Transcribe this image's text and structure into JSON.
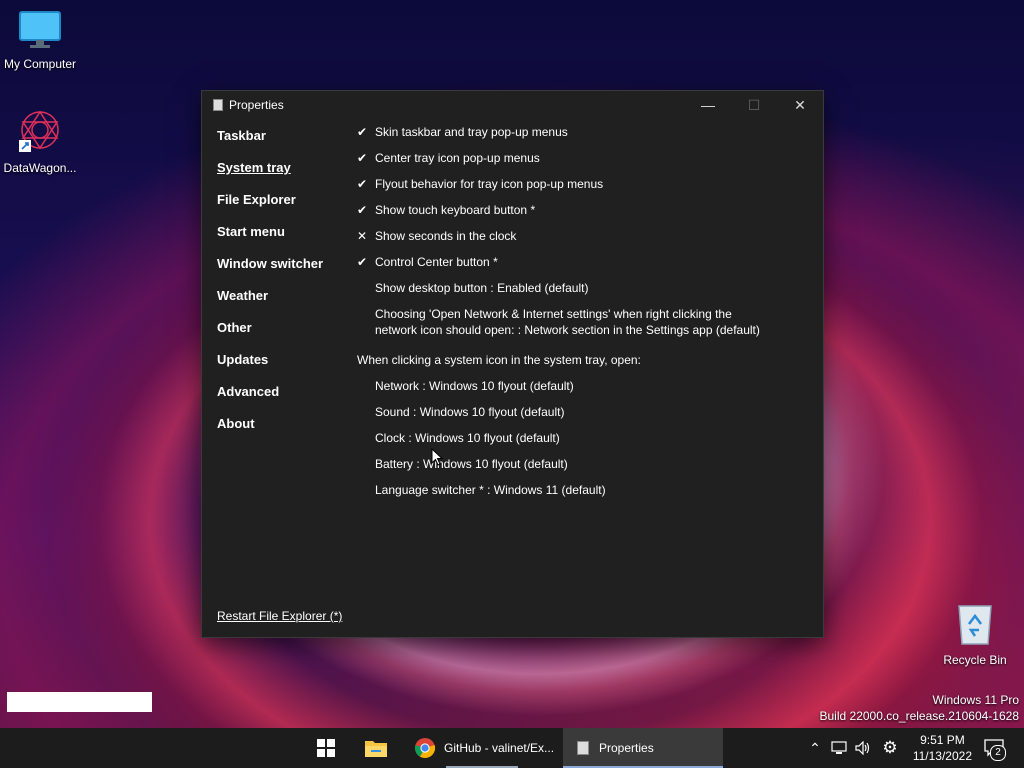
{
  "desktop": {
    "icons": [
      {
        "label": "My Computer"
      },
      {
        "label": "DataWagon..."
      },
      {
        "label": "Recycle Bin"
      }
    ],
    "watermark": {
      "line1": "Windows 11 Pro",
      "line2": "Build 22000.co_release.210604-1628"
    }
  },
  "window": {
    "title": "Properties",
    "controls": {
      "minimize": "—",
      "maximize": "☐",
      "close": "✕"
    },
    "nav": [
      "Taskbar",
      "System tray",
      "File Explorer",
      "Start menu",
      "Window switcher",
      "Weather",
      "Other",
      "Updates",
      "Advanced",
      "About"
    ],
    "active_nav": "System tray",
    "options": [
      {
        "mark": "✔",
        "text": "Skin taskbar and tray pop-up menus"
      },
      {
        "mark": "✔",
        "text": "Center tray icon pop-up menus"
      },
      {
        "mark": "✔",
        "text": "Flyout behavior for tray icon pop-up menus"
      },
      {
        "mark": "✔",
        "text": "Show touch keyboard button *"
      },
      {
        "mark": "✕",
        "text": "Show seconds in the clock"
      },
      {
        "mark": "✔",
        "text": "Control Center button *"
      },
      {
        "mark": "",
        "text": "Show desktop button : Enabled (default)"
      },
      {
        "mark": "",
        "text": "Choosing 'Open Network & Internet settings' when right clicking the network icon should open: : Network section in the Settings app (default)"
      }
    ],
    "section_heading": "When clicking a system icon in the system tray, open:",
    "sub_options": [
      "Network : Windows 10 flyout (default)",
      "Sound : Windows 10 flyout (default)",
      "Clock : Windows 10 flyout (default)",
      "Battery : Windows 10 flyout (default)",
      "Language switcher * : Windows 11 (default)"
    ],
    "restart_link": "Restart File Explorer (*)"
  },
  "taskbar": {
    "apps": [
      {
        "label": "GitHub - valinet/Ex..."
      },
      {
        "label": "Properties"
      }
    ],
    "time": "9:51 PM",
    "date": "11/13/2022",
    "notification_count": "2"
  }
}
